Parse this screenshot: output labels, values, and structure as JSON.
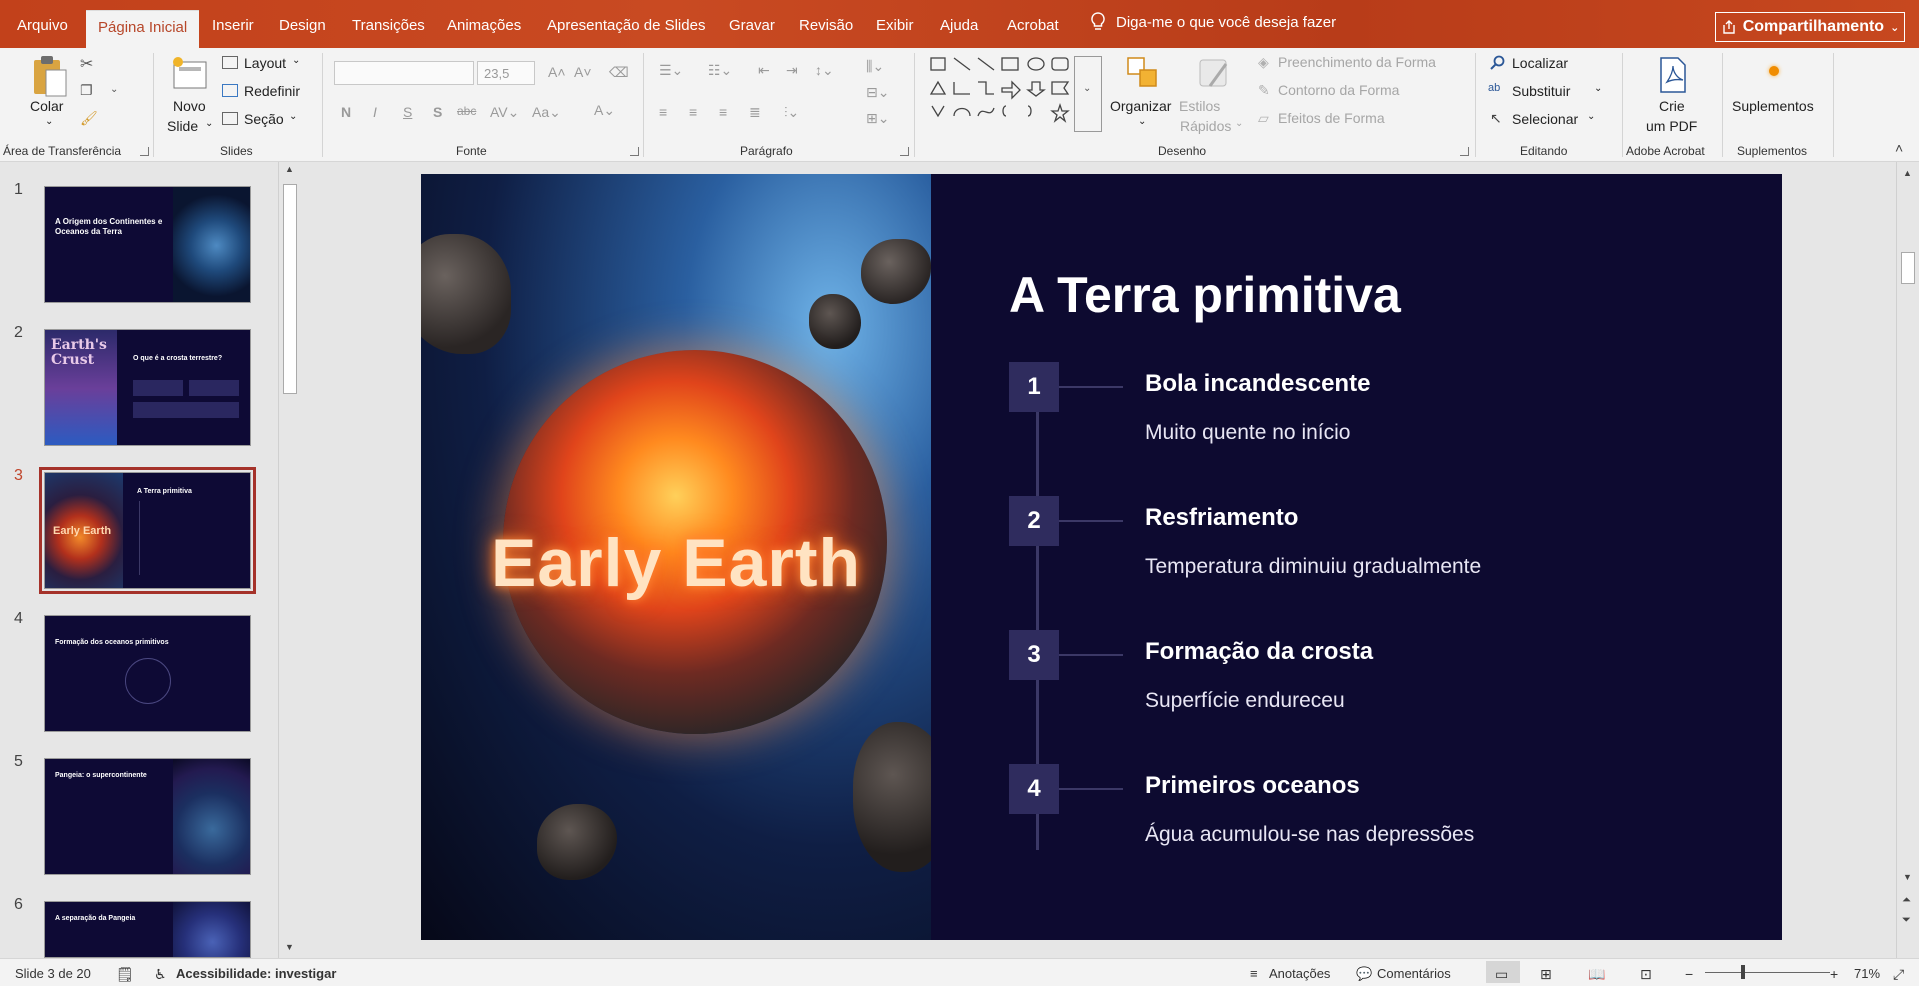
{
  "menu": {
    "tabs": [
      "Arquivo",
      "Página Inicial",
      "Inserir",
      "Design",
      "Transições",
      "Animações",
      "Apresentação de Slides",
      "Gravar",
      "Revisão",
      "Exibir",
      "Ajuda",
      "Acrobat"
    ],
    "tell_me": "Diga-me o que você deseja fazer",
    "share": "Compartilhamento"
  },
  "ribbon": {
    "clipboard": {
      "paste": "Colar",
      "label": "Área de Transferência"
    },
    "slides": {
      "new_slide": "Novo",
      "new_slide_2": "Slide",
      "layout": "Layout",
      "reset": "Redefinir",
      "section": "Seção",
      "label": "Slides"
    },
    "font": {
      "size": "23,5",
      "label": "Fonte"
    },
    "paragraph": {
      "label": "Parágrafo"
    },
    "drawing": {
      "arrange": "Organizar",
      "quick_styles": "Estilos",
      "quick_styles_2": "Rápidos",
      "fill": "Preenchimento da Forma",
      "outline": "Contorno da Forma",
      "effects": "Efeitos de Forma",
      "label": "Desenho"
    },
    "editing": {
      "find": "Localizar",
      "replace": "Substituir",
      "select": "Selecionar",
      "label": "Editando"
    },
    "acrobat": {
      "create": "Crie",
      "create_2": "um PDF",
      "label": "Adobe Acrobat"
    },
    "addins": {
      "addins": "Suplementos",
      "label": "Suplementos"
    }
  },
  "thumbnails": [
    {
      "num": "1",
      "title": "A Origem dos Continentes e Oceanos da Terra"
    },
    {
      "num": "2",
      "title": "O que é a crosta terrestre?",
      "image_text": "Earth's Crust"
    },
    {
      "num": "3",
      "title": "A Terra primitiva",
      "image_text": "Early Earth"
    },
    {
      "num": "4",
      "title": "Formação dos oceanos primitivos"
    },
    {
      "num": "5",
      "title": "Pangeia: o supercontinente"
    },
    {
      "num": "6",
      "title": "A separação da Pangeia"
    }
  ],
  "slide": {
    "title": "A Terra primitiva",
    "image_text": "Early Earth",
    "steps": [
      {
        "num": "1",
        "heading": "Bola incandescente",
        "desc": "Muito quente no início"
      },
      {
        "num": "2",
        "heading": "Resfriamento",
        "desc": "Temperatura diminuiu gradualmente"
      },
      {
        "num": "3",
        "heading": "Formação da crosta",
        "desc": "Superfície endureceu"
      },
      {
        "num": "4",
        "heading": "Primeiros oceanos",
        "desc": "Água acumulou-se nas depressões"
      }
    ]
  },
  "status": {
    "slide_count": "Slide 3 de 20",
    "accessibility": "Acessibilidade: investigar",
    "notes": "Anotações",
    "comments": "Comentários",
    "zoom": "71%"
  },
  "colors": {
    "accent": "#c2411b",
    "slide_bg": "#0d0a30",
    "step_box": "#2f2c5e"
  }
}
